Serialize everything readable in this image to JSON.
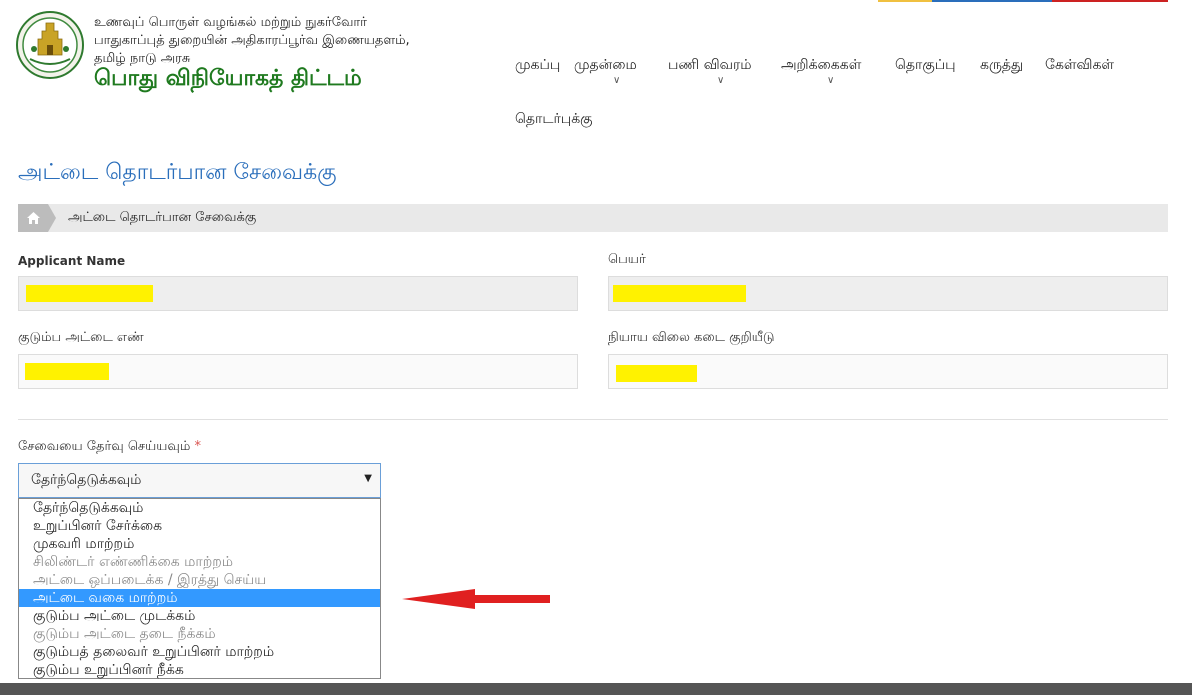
{
  "colors": {
    "top_segments": [
      "#f0c040",
      "#2a6ebb",
      "#2a6ebb",
      "#cc2222"
    ],
    "page_title": "#2a6ebb",
    "brand_title": "#1f7a1f",
    "highlight": "#fff200",
    "selected_option": "#3399ff",
    "arrow": "#e02020"
  },
  "header": {
    "line1": "உணவுப் பொருள் வழங்கல் மற்றும் நுகர்வோர்",
    "line2": "பாதுகாப்புத் துறையின் அதிகாரப்பூர்வ இணையதளம்,",
    "line3": "தமிழ் நாடு அரசு",
    "title": "பொது விநியோகத் திட்டம்",
    "logo_icon": "tamil-nadu-emblem-icon"
  },
  "nav": {
    "items": [
      {
        "label": "முகப்பு",
        "dropdown": false
      },
      {
        "label": "முதன்மை",
        "dropdown": true
      },
      {
        "label": "பணி விவரம்",
        "dropdown": true
      },
      {
        "label": "அறிக்கைகள்",
        "dropdown": true
      },
      {
        "label": "தொகுப்பு",
        "dropdown": false
      },
      {
        "label": "கருத்து",
        "dropdown": false
      },
      {
        "label": "கேள்விகள்",
        "dropdown": false
      },
      {
        "label": "தொடர்புக்கு",
        "dropdown": false
      }
    ],
    "caret_icon": "chevron-down-icon"
  },
  "page": {
    "title": "அட்டை தொடர்பான சேவைக்கு",
    "breadcrumb": "அட்டை தொடர்பான சேவைக்கு",
    "home_icon": "home-icon"
  },
  "form": {
    "applicant_name_label": "Applicant Name",
    "name_tamil_label": "பெயர்",
    "family_card_label": "குடும்ப அட்டை எண்",
    "shop_code_label": "நியாய விலை கடை குறியீடு",
    "service_label": "சேவையை தேர்வு செய்யவும்",
    "required_mark": "*",
    "selected_value": "தேர்ந்தெடுக்கவும்",
    "options": [
      {
        "label": "தேர்ந்தெடுக்கவும்",
        "state": "normal"
      },
      {
        "label": "உறுப்பினர் சேர்க்கை",
        "state": "normal"
      },
      {
        "label": "முகவரி மாற்றம்",
        "state": "normal"
      },
      {
        "label": "சிலிண்டர் எண்ணிக்கை மாற்றம்",
        "state": "disabled"
      },
      {
        "label": "அட்டை ஒப்படைக்க / இரத்து செய்ய",
        "state": "disabled"
      },
      {
        "label": "அட்டை வகை மாற்றம்",
        "state": "selected"
      },
      {
        "label": "குடும்ப அட்டை முடக்கம்",
        "state": "normal"
      },
      {
        "label": "குடும்ப அட்டை தடை நீக்கம்",
        "state": "disabled"
      },
      {
        "label": "குடும்பத் தலைவர் உறுப்பினர் மாற்றம்",
        "state": "normal"
      },
      {
        "label": "குடும்ப உறுப்பினர் நீக்க",
        "state": "normal"
      }
    ]
  }
}
